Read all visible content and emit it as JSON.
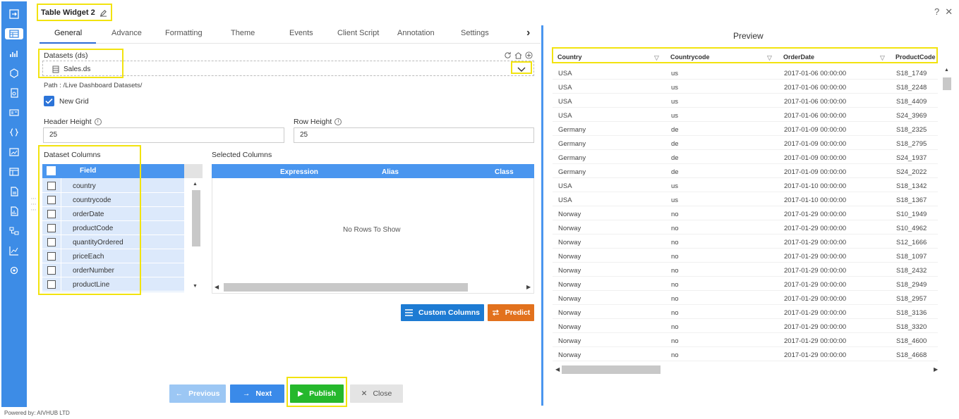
{
  "app": {
    "title": "Table Widget 2",
    "footer": "Powered by: AIVHUB LTD"
  },
  "tabs": [
    {
      "label": "General",
      "active": true
    },
    {
      "label": "Advance"
    },
    {
      "label": "Formatting"
    },
    {
      "label": "Theme"
    },
    {
      "label": "Events"
    },
    {
      "label": "Client Script"
    },
    {
      "label": "Annotation"
    },
    {
      "label": "Settings"
    }
  ],
  "datasets": {
    "label": "Datasets (ds)",
    "value": "Sales.ds",
    "path": "Path : /Live Dashboard Datasets/"
  },
  "new_grid": {
    "label": "New Grid",
    "checked": true
  },
  "header_height": {
    "label": "Header Height",
    "value": "25"
  },
  "row_height": {
    "label": "Row Height",
    "value": "25"
  },
  "dataset_columns": {
    "title": "Dataset Columns",
    "header": "Field",
    "rows": [
      "country",
      "countrycode",
      "orderDate",
      "productCode",
      "quantityOrdered",
      "priceEach",
      "orderNumber",
      "productLine"
    ]
  },
  "selected_columns": {
    "title": "Selected Columns",
    "headers": [
      "Expression",
      "Alias",
      "Class"
    ],
    "empty_text": "No Rows To Show"
  },
  "buttons": {
    "custom_columns": "Custom Columns",
    "predict": "Predict",
    "previous": "Previous",
    "next": "Next",
    "publish": "Publish",
    "close": "Close"
  },
  "preview": {
    "title": "Preview",
    "headers": [
      "Country",
      "Countrycode",
      "OrderDate",
      "ProductCode"
    ],
    "rows": [
      [
        "USA",
        "us",
        "2017-01-06 00:00:00",
        "S18_1749"
      ],
      [
        "USA",
        "us",
        "2017-01-06 00:00:00",
        "S18_2248"
      ],
      [
        "USA",
        "us",
        "2017-01-06 00:00:00",
        "S18_4409"
      ],
      [
        "USA",
        "us",
        "2017-01-06 00:00:00",
        "S24_3969"
      ],
      [
        "Germany",
        "de",
        "2017-01-09 00:00:00",
        "S18_2325"
      ],
      [
        "Germany",
        "de",
        "2017-01-09 00:00:00",
        "S18_2795"
      ],
      [
        "Germany",
        "de",
        "2017-01-09 00:00:00",
        "S24_1937"
      ],
      [
        "Germany",
        "de",
        "2017-01-09 00:00:00",
        "S24_2022"
      ],
      [
        "USA",
        "us",
        "2017-01-10 00:00:00",
        "S18_1342"
      ],
      [
        "USA",
        "us",
        "2017-01-10 00:00:00",
        "S18_1367"
      ],
      [
        "Norway",
        "no",
        "2017-01-29 00:00:00",
        "S10_1949"
      ],
      [
        "Norway",
        "no",
        "2017-01-29 00:00:00",
        "S10_4962"
      ],
      [
        "Norway",
        "no",
        "2017-01-29 00:00:00",
        "S12_1666"
      ],
      [
        "Norway",
        "no",
        "2017-01-29 00:00:00",
        "S18_1097"
      ],
      [
        "Norway",
        "no",
        "2017-01-29 00:00:00",
        "S18_2432"
      ],
      [
        "Norway",
        "no",
        "2017-01-29 00:00:00",
        "S18_2949"
      ],
      [
        "Norway",
        "no",
        "2017-01-29 00:00:00",
        "S18_2957"
      ],
      [
        "Norway",
        "no",
        "2017-01-29 00:00:00",
        "S18_3136"
      ],
      [
        "Norway",
        "no",
        "2017-01-29 00:00:00",
        "S18_3320"
      ],
      [
        "Norway",
        "no",
        "2017-01-29 00:00:00",
        "S18_4600"
      ],
      [
        "Norway",
        "no",
        "2017-01-29 00:00:00",
        "S18_4668"
      ]
    ]
  },
  "nav_icons": [
    "sign-in-icon",
    "table-icon",
    "chart-icon",
    "cube-icon",
    "report-icon",
    "id-card-icon",
    "code-braces-icon",
    "image-chart-icon",
    "layout-icon",
    "document-icon",
    "file-chart-icon",
    "hierarchy-icon",
    "line-chart-icon",
    "settings-chip-icon"
  ],
  "colors": {
    "nav": "#3d8ce6",
    "header": "#4a96ef",
    "publish": "#25b82c",
    "predict": "#e2711d",
    "custom": "#1d7bd3",
    "highlight": "#f2e30f"
  }
}
